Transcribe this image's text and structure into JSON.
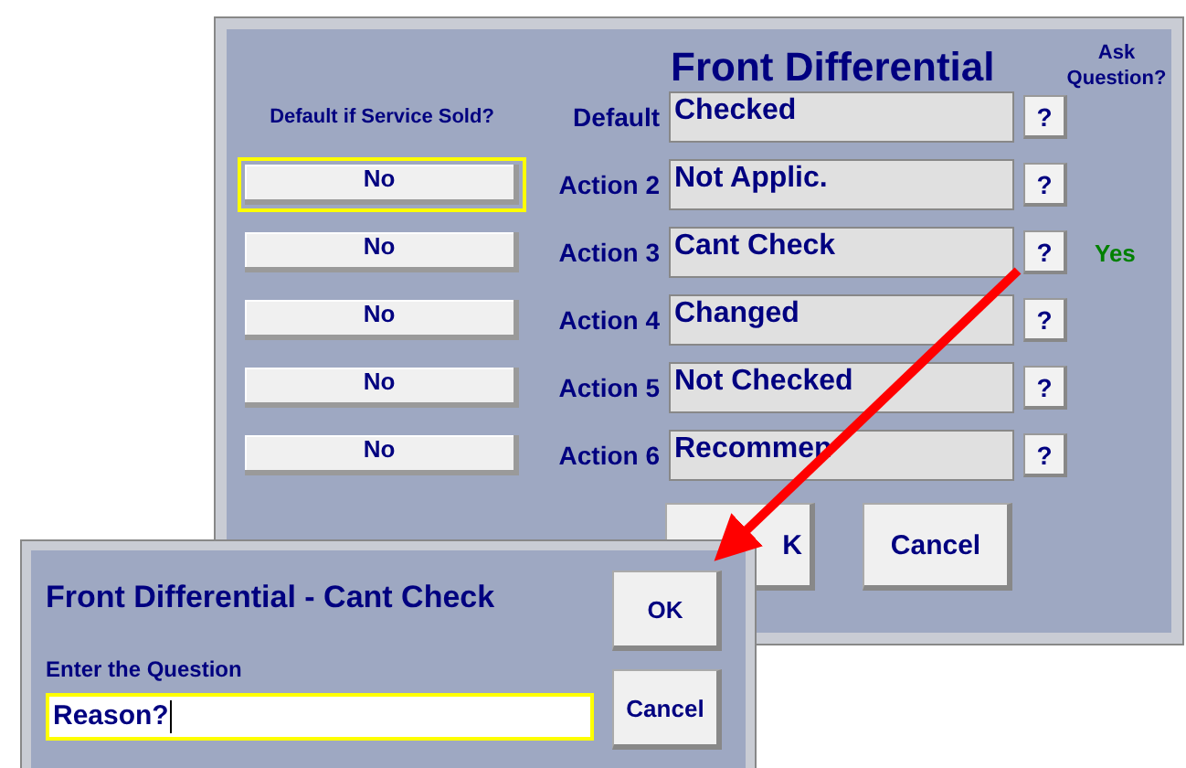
{
  "main_dialog": {
    "title": "Front Differential",
    "ask_header": "Ask Question?",
    "rows": [
      {
        "kind": "caption",
        "caption": "Default if Service Sold?",
        "label": "Default",
        "value": "Checked",
        "help": "?"
      },
      {
        "kind": "action",
        "button": "No",
        "selected": true,
        "label": "Action 2",
        "value": "Not Applic.",
        "help": "?"
      },
      {
        "kind": "action",
        "button": "No",
        "selected": false,
        "label": "Action 3",
        "value": "Cant Check",
        "help": "?",
        "ask": "Yes"
      },
      {
        "kind": "action",
        "button": "No",
        "selected": false,
        "label": "Action 4",
        "value": "Changed",
        "help": "?"
      },
      {
        "kind": "action",
        "button": "No",
        "selected": false,
        "label": "Action 5",
        "value": "Not Checked",
        "help": "?"
      },
      {
        "kind": "action",
        "button": "No",
        "selected": false,
        "label": "Action 6",
        "value": "Recommen",
        "help": "?"
      }
    ],
    "buttons": [
      "K",
      "Cancel"
    ]
  },
  "question_dialog": {
    "title": "Front Differential - Cant Check",
    "prompt": "Enter the Question",
    "answer": "Reason?",
    "buttons": [
      "OK",
      "Cancel"
    ]
  }
}
